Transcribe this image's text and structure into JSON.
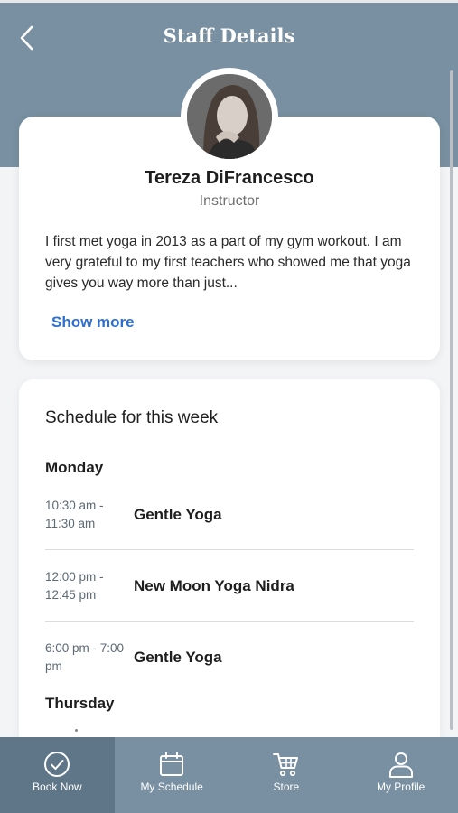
{
  "header": {
    "title": "Staff Details"
  },
  "profile": {
    "name": "Tereza DiFrancesco",
    "role": "Instructor",
    "bio": "I first met yoga in 2013 as a part of my gym workout. I am very grateful to my first teachers who showed me that yoga gives you way more than just...",
    "show_more_label": "Show more"
  },
  "schedule": {
    "title": "Schedule for this week",
    "days": [
      {
        "label": "Monday",
        "classes": [
          {
            "time": "10:30 am - 11:30 am",
            "name": "Gentle Yoga"
          },
          {
            "time": "12:00 pm - 12:45 pm",
            "name": "New Moon Yoga Nidra"
          },
          {
            "time": "6:00 pm - 7:00 pm",
            "name": "Gentle Yoga"
          }
        ]
      },
      {
        "label": "Thursday",
        "classes": []
      }
    ]
  },
  "tabbar": {
    "active": "Book Now",
    "tabs": [
      {
        "label": "Book Now",
        "icon": "check-circle-icon"
      },
      {
        "label": "My Schedule",
        "icon": "calendar-icon"
      },
      {
        "label": "Store",
        "icon": "cart-icon"
      },
      {
        "label": "My Profile",
        "icon": "person-icon"
      }
    ]
  },
  "colors": {
    "header_bg": "#7890a1",
    "active_tab_bg": "#5e7687",
    "link": "#2f6fd0"
  }
}
